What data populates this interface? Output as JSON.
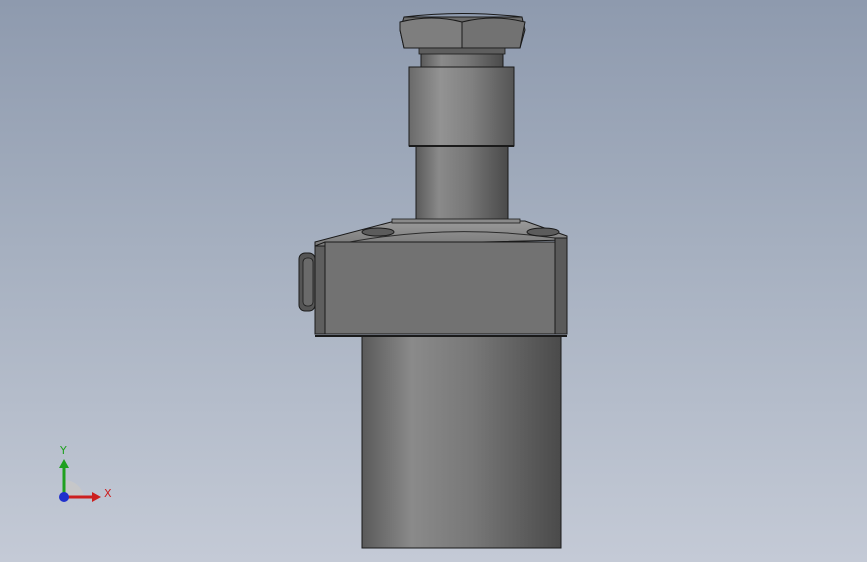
{
  "viewport": {
    "background_top": "#8e9aae",
    "background_bottom": "#c4cad6"
  },
  "model": {
    "part_color": "#6f6f6f",
    "edge_color": "#1a1a1a"
  },
  "triad": {
    "x_label": "X",
    "y_label": "Y",
    "x_color": "#cc1f1f",
    "y_color": "#1fa01f",
    "z_color": "#1f2fcc"
  }
}
